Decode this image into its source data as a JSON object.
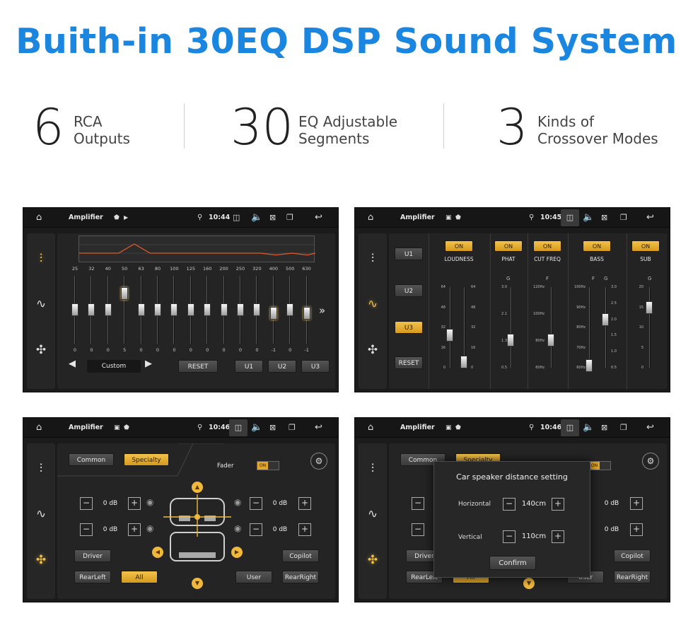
{
  "header": {
    "title": "Buith-in 30EQ DSP Sound System",
    "stats": [
      {
        "num": "6",
        "line1": "RCA",
        "line2": "Outputs"
      },
      {
        "num": "30",
        "line1": "EQ Adjustable",
        "line2": "Segments"
      },
      {
        "num": "3",
        "line1": "Kinds of",
        "line2": "Crossover Modes"
      }
    ]
  },
  "app_title": "Amplifier",
  "screens": {
    "eq": {
      "time": "10:44",
      "preset": "Custom",
      "reset_label": "RESET",
      "user_presets": [
        "U1",
        "U2",
        "U3"
      ],
      "more_glyph": "»",
      "bands": [
        {
          "freq": "25",
          "value": "0",
          "level": 0
        },
        {
          "freq": "32",
          "value": "0",
          "level": 0
        },
        {
          "freq": "40",
          "value": "0",
          "level": 0
        },
        {
          "freq": "50",
          "value": "5",
          "level": 5
        },
        {
          "freq": "63",
          "value": "0",
          "level": 0
        },
        {
          "freq": "80",
          "value": "0",
          "level": 0
        },
        {
          "freq": "100",
          "value": "0",
          "level": 0
        },
        {
          "freq": "125",
          "value": "0",
          "level": 0
        },
        {
          "freq": "160",
          "value": "0",
          "level": 0
        },
        {
          "freq": "200",
          "value": "0",
          "level": 0
        },
        {
          "freq": "250",
          "value": "0",
          "level": 0
        },
        {
          "freq": "320",
          "value": "0",
          "level": 0
        },
        {
          "freq": "400",
          "value": "-1",
          "level": -1
        },
        {
          "freq": "500",
          "value": "0",
          "level": 0
        },
        {
          "freq": "630",
          "value": "-1",
          "level": -1
        }
      ]
    },
    "crossover": {
      "time": "10:45",
      "presets": [
        "U1",
        "U2",
        "U3"
      ],
      "active_preset": "U3",
      "reset_label": "RESET",
      "on_label": "ON",
      "filters": [
        {
          "name": "LOUDNESS"
        },
        {
          "name": "PHAT",
          "glyph": "G"
        },
        {
          "name": "CUT FREQ",
          "glyph": "F"
        },
        {
          "name": "BASS",
          "glyph_f": "F",
          "glyph_g": "G"
        },
        {
          "name": "SUB",
          "glyph": "G"
        }
      ],
      "loudness_scale": [
        "64",
        "48",
        "32",
        "16",
        "0"
      ],
      "phat_scale": [
        "3.0",
        "2.1",
        "1.3",
        "0.5"
      ],
      "cut_scale": [
        "120Hz",
        "100Hz",
        "80Hz",
        "60Hz"
      ],
      "bass_f_scale": [
        "100Hz",
        "90Hz",
        "80Hz",
        "70Hz",
        "60Hz"
      ],
      "bass_g_scale": [
        "3.0",
        "2.5",
        "2.0",
        "1.5",
        "1.0",
        "0.5"
      ],
      "sub_scale": [
        "20",
        "15",
        "10",
        "5",
        "0"
      ]
    },
    "field1": {
      "time": "10:46",
      "tabs": [
        "Common",
        "Specialty"
      ],
      "active_tab": "Specialty",
      "fader_label": "Fader",
      "fader_on": "ON",
      "levels": [
        "0 dB",
        "0 dB",
        "0 dB",
        "0 dB"
      ],
      "seats": [
        "Driver",
        "Copilot",
        "RearLeft",
        "All",
        "User",
        "RearRight"
      ],
      "active_seat": "All",
      "minus": "−",
      "plus": "+"
    },
    "field2": {
      "time": "10:46",
      "tabs": [
        "Common",
        "Specialty"
      ],
      "fader_on": "ON",
      "levels": [
        "0 dB",
        "0 dB"
      ],
      "seats": [
        "Driver",
        "Copilot",
        "RearLeft",
        "All",
        "User",
        "RearRight"
      ],
      "dialog": {
        "title": "Car speaker distance setting",
        "horizontal_label": "Horizontal",
        "horizontal_value": "140cm",
        "vertical_label": "Vertical",
        "vertical_value": "110cm",
        "confirm_label": "Confirm"
      }
    }
  },
  "colors": {
    "accent_blue": "#1a86e0",
    "accent_gold": "#f0b93c",
    "graph_line": "#e05a2a"
  },
  "icons": {
    "home": "home-icon",
    "location": "location-icon",
    "camera": "camera-icon",
    "volume": "volume-icon",
    "close": "close-box-icon",
    "window": "window-icon",
    "back": "back-icon",
    "eq": "equalizer-icon",
    "wave": "waveform-icon",
    "field": "sound-field-icon"
  }
}
